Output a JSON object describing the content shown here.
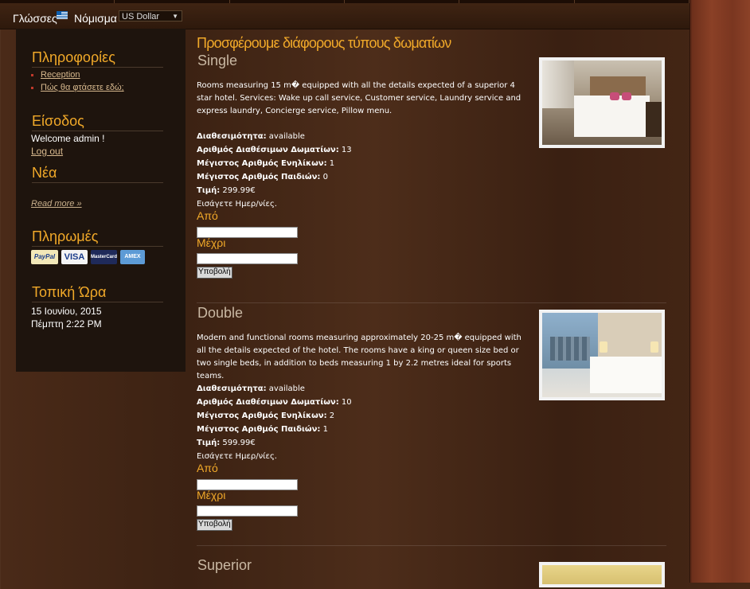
{
  "topbar": {
    "languages_label": "Γλώσσες",
    "currency_label": "Νόμισμα",
    "currency_selected": "US Dollar"
  },
  "sidebar": {
    "info_title": "Πληροφορίες",
    "info_links": [
      "Reception",
      "Πώς θα φτάσετε εδώ;"
    ],
    "login_title": "Είσοδος",
    "welcome_text": "Welcome admin !",
    "logout_text": "Log out",
    "news_title": "Νέα",
    "read_more": "Read more »",
    "payments_title": "Πληρωμές",
    "payment_methods": [
      "PayPal",
      "VISA",
      "MasterCard",
      "AMEX"
    ],
    "time_title": "Τοπική Ώρα",
    "date": "15 Ιουνίου, 2015",
    "day_time": "Πέμπτη 2:22 PM"
  },
  "main": {
    "heading": "Προσφέρουμε διάφορους τύπους δωματίων",
    "labels": {
      "availability": "Διαθεσιμότητα:",
      "rooms_available": "Αριθμός Διαθέσιμων Δωματίων:",
      "max_adults": "Μέγιστος Αριθμός Ενηλίκων:",
      "max_children": "Μέγιστος Αριθμός Παιδιών:",
      "price": "Τιμή:",
      "enter_dates": "Εισάγετε Ημερ/νίες.",
      "from": "Από",
      "to": "Μέχρι",
      "submit": "Υποβολή"
    },
    "rooms": [
      {
        "name": "Single",
        "description": "Rooms measuring 15 m� equipped with all the details expected of a superior 4 star hotel. Services: Wake up call service, Customer service, Laundry service and express laundry, Concierge service, Pillow menu.",
        "availability": "available",
        "rooms_available": "13",
        "max_adults": "1",
        "max_children": "0",
        "price": "299.99€"
      },
      {
        "name": "Double",
        "description": "Modern and functional rooms measuring approximately 20-25 m� equipped with all the details expected of the hotel. The rooms have a king or queen size bed or two single beds, in addition to beds measuring 1 by 2.2 metres ideal for sports teams.",
        "availability": "available",
        "rooms_available": "10",
        "max_adults": "2",
        "max_children": "1",
        "price": "599.99€"
      },
      {
        "name": "Superior"
      }
    ]
  }
}
